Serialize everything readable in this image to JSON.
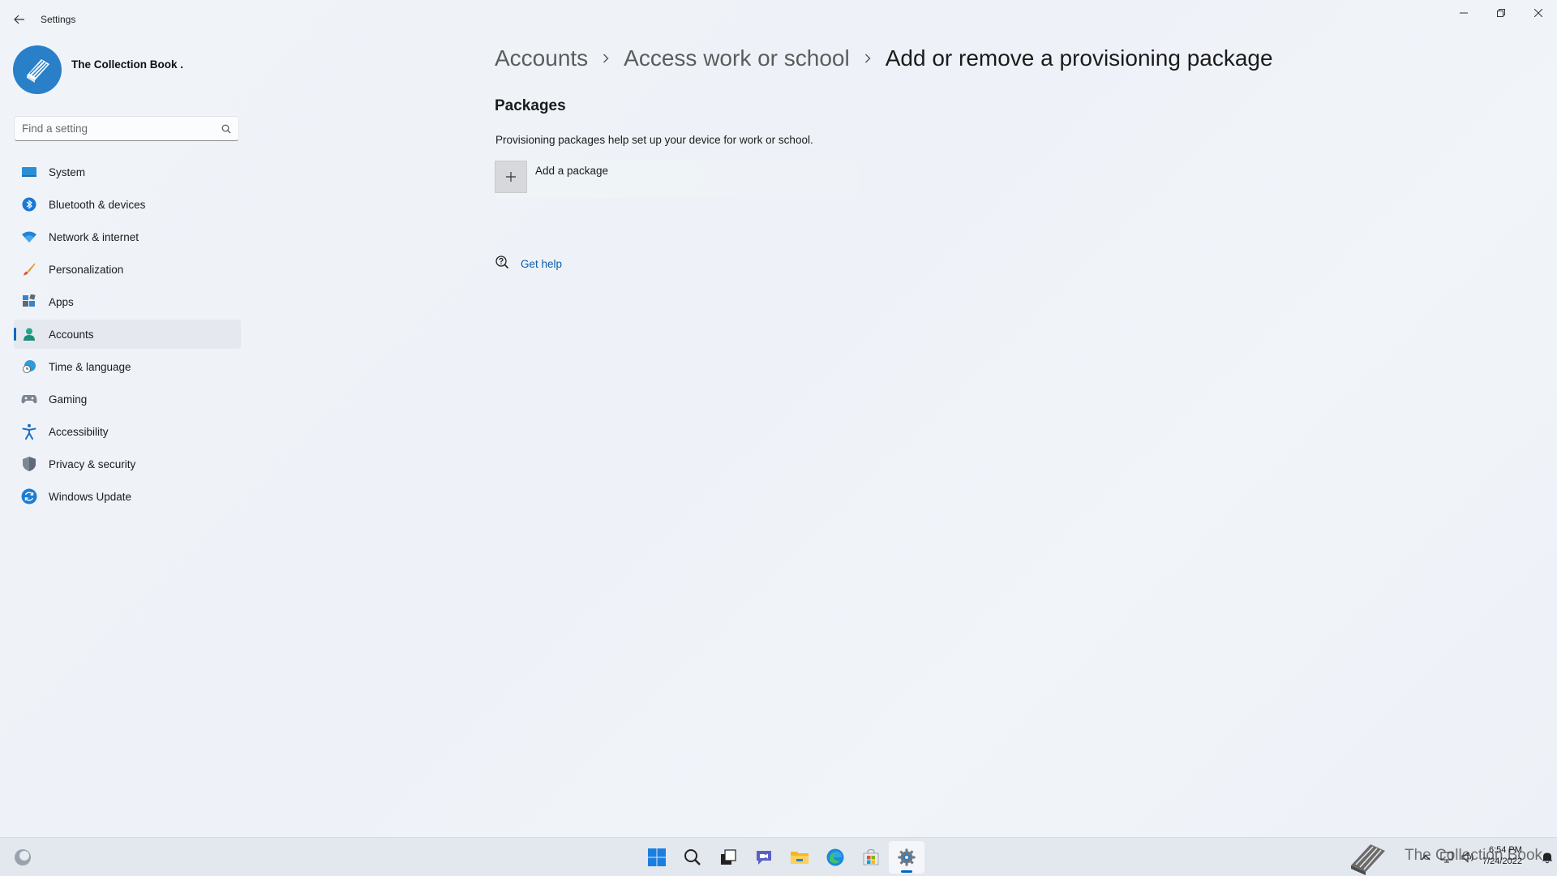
{
  "window": {
    "app_title": "Settings"
  },
  "profile": {
    "name": "The Collection Book ."
  },
  "search": {
    "placeholder": "Find a setting"
  },
  "sidebar": {
    "items": [
      {
        "label": "System",
        "icon": "system-icon"
      },
      {
        "label": "Bluetooth & devices",
        "icon": "bluetooth-icon"
      },
      {
        "label": "Network & internet",
        "icon": "wifi-icon"
      },
      {
        "label": "Personalization",
        "icon": "brush-icon"
      },
      {
        "label": "Apps",
        "icon": "apps-icon"
      },
      {
        "label": "Accounts",
        "icon": "accounts-icon",
        "active": true
      },
      {
        "label": "Time & language",
        "icon": "globe-clock-icon"
      },
      {
        "label": "Gaming",
        "icon": "gamepad-icon"
      },
      {
        "label": "Accessibility",
        "icon": "accessibility-icon"
      },
      {
        "label": "Privacy & security",
        "icon": "shield-icon"
      },
      {
        "label": "Windows Update",
        "icon": "update-icon"
      }
    ]
  },
  "breadcrumb": {
    "level1": "Accounts",
    "level2": "Access work or school",
    "current": "Add or remove a provisioning package"
  },
  "main": {
    "section_title": "Packages",
    "description": "Provisioning packages help set up your device for work or school.",
    "add_package_label": "Add a package",
    "get_help_label": "Get help"
  },
  "taskbar": {
    "watermark": "The Collection Book",
    "time": "6:54 PM",
    "date": "7/24/2022"
  },
  "colors": {
    "accent": "#0067c0",
    "link": "#0b5cad"
  }
}
